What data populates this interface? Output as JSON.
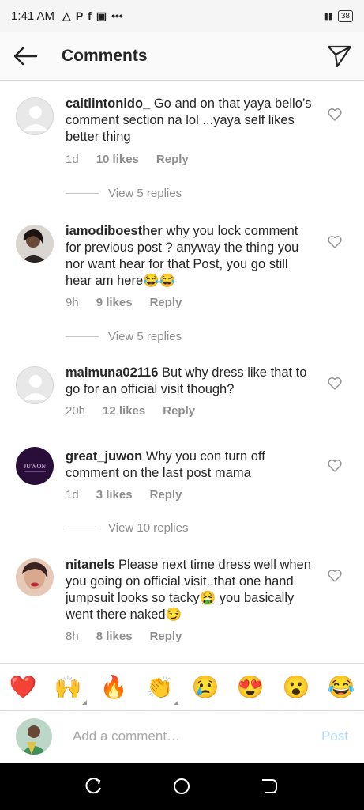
{
  "status_bar": {
    "time": "1:41 AM",
    "icons": [
      "warning-icon",
      "p-icon",
      "facebook-icon",
      "gallery-icon",
      "more-dots-icon"
    ],
    "battery": "38"
  },
  "header": {
    "title": "Comments"
  },
  "comments": [
    {
      "username": "caitlintonido_",
      "text": "Go and on that yaya bello’s comment section na lol ...yaya self likes better thing",
      "time": "1d",
      "likes": "10 likes",
      "reply": "Reply",
      "view_replies": "View 5 replies",
      "avatar": "default"
    },
    {
      "username": "iamodiboesther",
      "text": "why you lock comment for previous post ? anyway the thing you nor want hear for that Post, you go still hear am here😂😂",
      "time": "9h",
      "likes": "9 likes",
      "reply": "Reply",
      "view_replies": "View 5 replies",
      "avatar": "photo"
    },
    {
      "username": "maimuna02116",
      "text": "But why dress like that to go for an official visit though?",
      "time": "20h",
      "likes": "12 likes",
      "reply": "Reply",
      "view_replies": "",
      "avatar": "default"
    },
    {
      "username": "great_juwon",
      "text": "Why you con turn off comment on the last post mama",
      "time": "1d",
      "likes": "3 likes",
      "reply": "Reply",
      "view_replies": "View 10 replies",
      "avatar": "logo",
      "avatar_text": "JUWON"
    },
    {
      "username": "nitanels",
      "text": "Please next time dress well when you going on official visit..that one hand jumpsuit looks so tacky🤮 you basically went there naked😏",
      "time": "8h",
      "likes": "8 likes",
      "reply": "Reply",
      "view_replies": "",
      "avatar": "photo"
    }
  ],
  "emoji_bar": [
    "❤️",
    "🙌",
    "🔥",
    "👏",
    "😢",
    "😍",
    "😮",
    "😂"
  ],
  "input": {
    "placeholder": "Add a comment…",
    "post_label": "Post"
  },
  "colors": {
    "accent": "#b3dbff",
    "muted": "#8e8e8e",
    "text": "#262626"
  }
}
